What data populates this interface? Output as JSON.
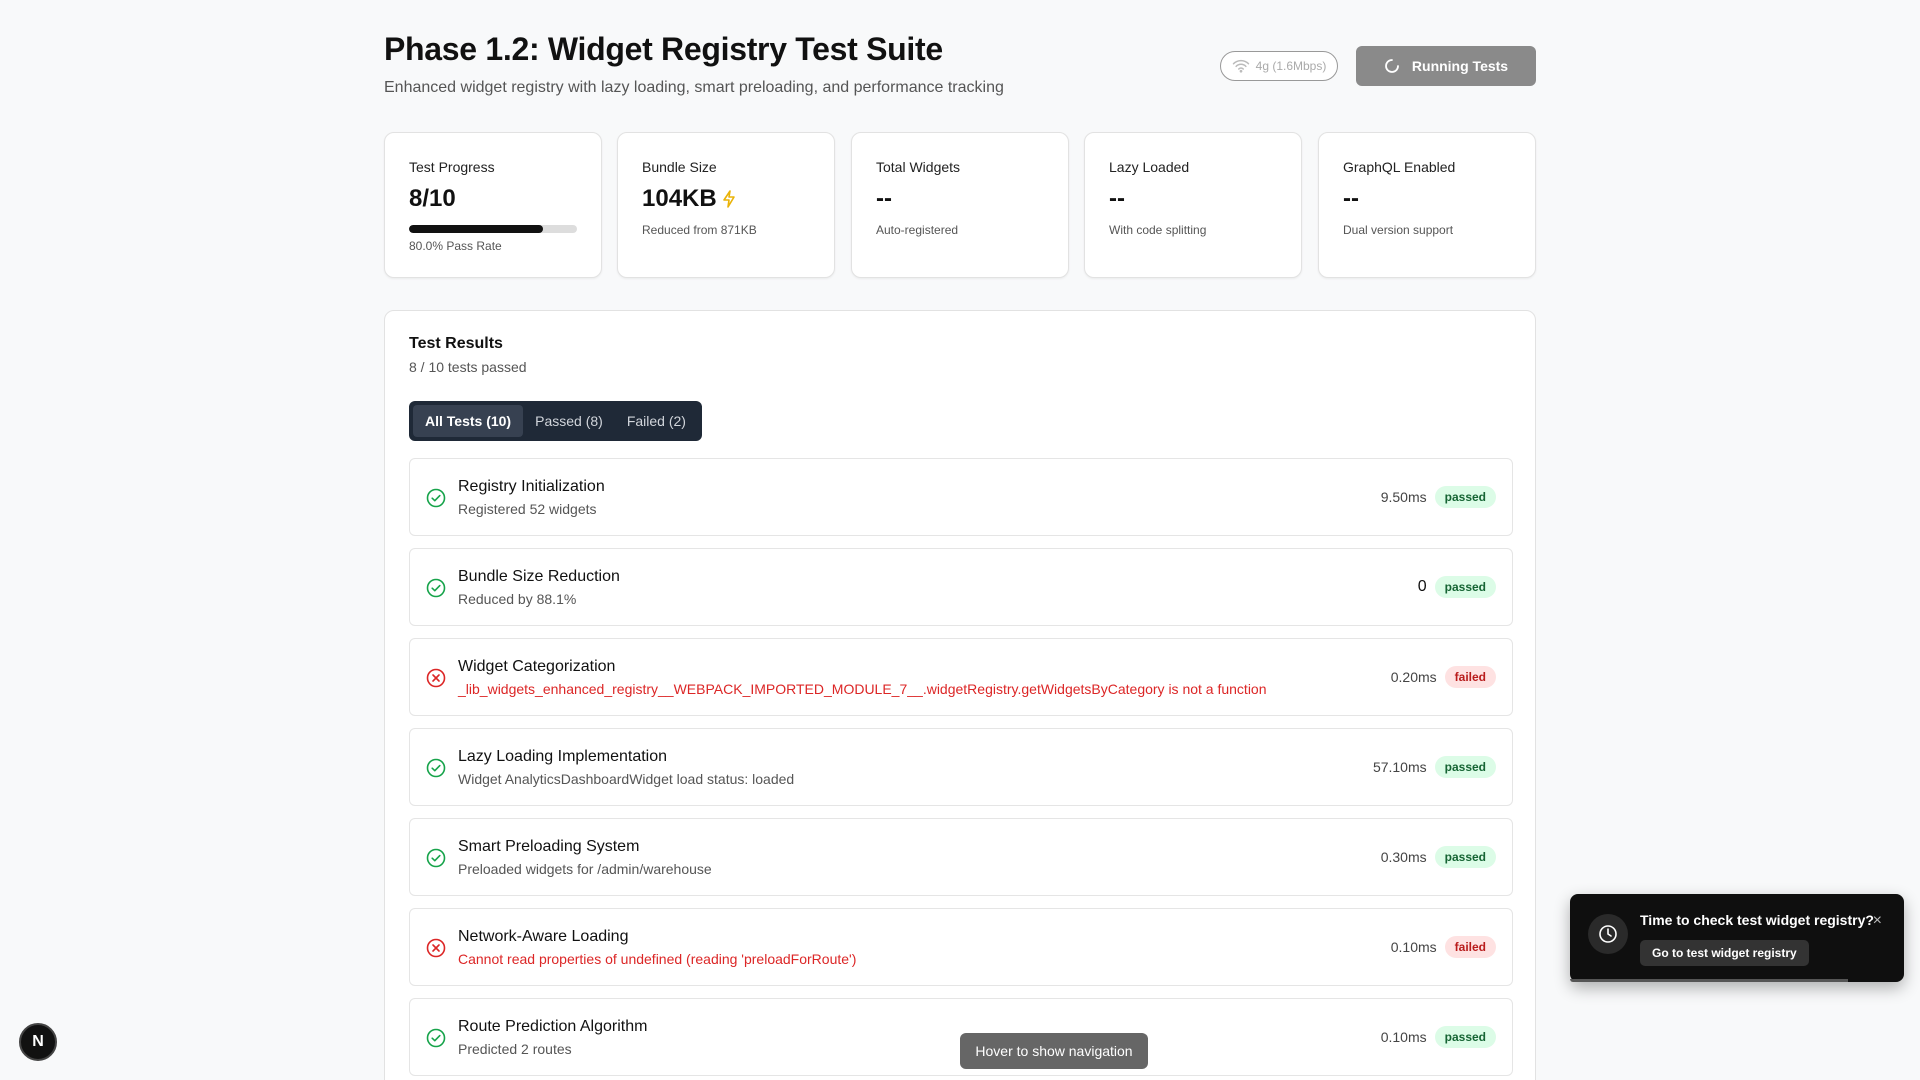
{
  "header": {
    "title": "Phase 1.2: Widget Registry Test Suite",
    "subtitle": "Enhanced widget registry with lazy loading, smart preloading, and performance tracking",
    "network_label": "4g (1.6Mbps)",
    "run_button_label": "Running Tests"
  },
  "stats": [
    {
      "label": "Test Progress",
      "value": "8/10",
      "sub": "80.0% Pass Rate",
      "progress": 0.8
    },
    {
      "label": "Bundle Size",
      "value": "104KB",
      "sub": "Reduced from 871KB",
      "icon": "bolt-icon",
      "icon_color": "#eab308"
    },
    {
      "label": "Total Widgets",
      "value": "--",
      "sub": "Auto-registered"
    },
    {
      "label": "Lazy Loaded",
      "value": "--",
      "sub": "With code splitting"
    },
    {
      "label": "GraphQL Enabled",
      "value": "--",
      "sub": "Dual version support"
    }
  ],
  "results": {
    "title": "Test Results",
    "summary": "8 / 10 tests passed",
    "tabs": [
      {
        "label": "All Tests (10)",
        "active": true
      },
      {
        "label": "Passed (8)",
        "active": false
      },
      {
        "label": "Failed (2)",
        "active": false
      }
    ],
    "tests": [
      {
        "name": "Registry Initialization",
        "detail": "Registered 52 widgets",
        "time": "9.50ms",
        "status": "passed"
      },
      {
        "name": "Bundle Size Reduction",
        "detail": "Reduced by 88.1%",
        "time": "0",
        "status": "passed"
      },
      {
        "name": "Widget Categorization",
        "detail": "_lib_widgets_enhanced_registry__WEBPACK_IMPORTED_MODULE_7__.widgetRegistry.getWidgetsByCategory is not a function",
        "time": "0.20ms",
        "status": "failed"
      },
      {
        "name": "Lazy Loading Implementation",
        "detail": "Widget AnalyticsDashboardWidget load status: loaded",
        "time": "57.10ms",
        "status": "passed"
      },
      {
        "name": "Smart Preloading System",
        "detail": "Preloaded widgets for /admin/warehouse",
        "time": "0.30ms",
        "status": "passed"
      },
      {
        "name": "Network-Aware Loading",
        "detail": "Cannot read properties of undefined (reading 'preloadForRoute')",
        "time": "0.10ms",
        "status": "failed"
      },
      {
        "name": "Route Prediction Algorithm",
        "detail": "Predicted 2 routes",
        "time": "0.10ms",
        "status": "passed"
      }
    ]
  },
  "colors": {
    "passed": "#16a34a",
    "failed": "#dc2626",
    "tabs_bg": "#1f2937"
  },
  "overlay": {
    "next_badge": "N",
    "hover_nav": "Hover to show navigation",
    "toast": {
      "message": "Time to check test widget registry?",
      "button": "Go to test widget registry",
      "close": "×"
    }
  }
}
